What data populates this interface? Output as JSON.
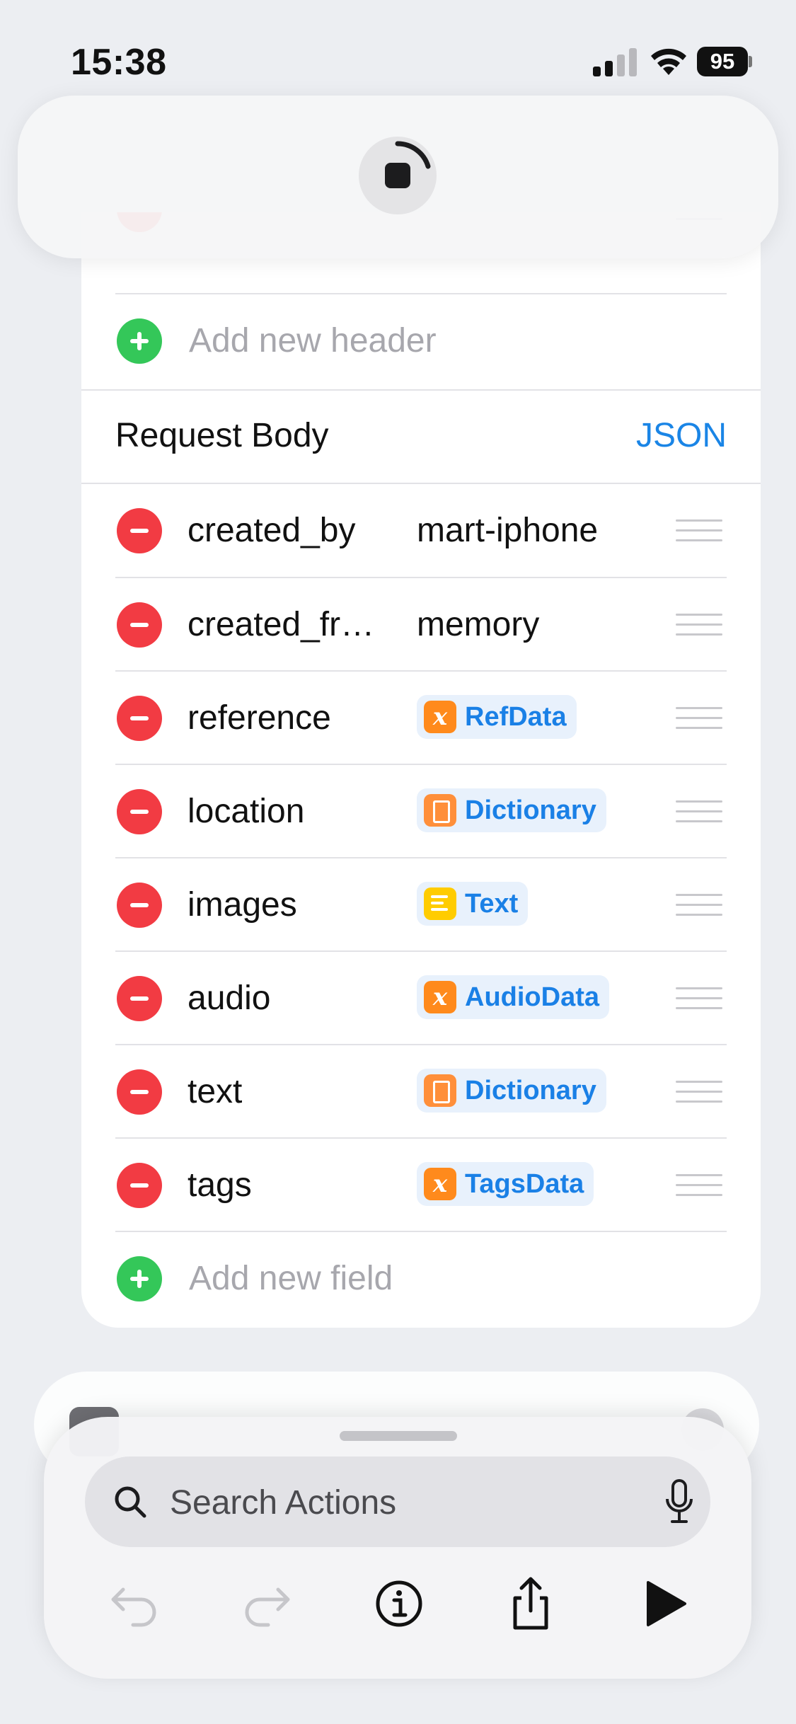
{
  "status_bar": {
    "time": "15:38",
    "battery": "95"
  },
  "headers": {
    "add_placeholder": "Add new header"
  },
  "request_body": {
    "title": "Request Body",
    "format": "JSON",
    "fields": [
      {
        "key": "created_by",
        "type": "text",
        "value": "mart-iphone"
      },
      {
        "key": "created_fr…",
        "type": "text",
        "value": "memory"
      },
      {
        "key": "reference",
        "type": "variable",
        "value": "RefData",
        "icon": "variable-x-icon",
        "color": "#ff8a1c"
      },
      {
        "key": "location",
        "type": "variable",
        "value": "Dictionary",
        "icon": "dictionary-book-icon",
        "color": "#ff8f3a"
      },
      {
        "key": "images",
        "type": "variable",
        "value": "Text",
        "icon": "text-lines-icon",
        "color": "#ffcc00"
      },
      {
        "key": "audio",
        "type": "variable",
        "value": "AudioData",
        "icon": "variable-x-icon",
        "color": "#ff8a1c"
      },
      {
        "key": "text",
        "type": "variable",
        "value": "Dictionary",
        "icon": "dictionary-book-icon",
        "color": "#ff8f3a"
      },
      {
        "key": "tags",
        "type": "variable",
        "value": "TagsData",
        "icon": "variable-x-icon",
        "color": "#ff8a1c"
      }
    ],
    "add_placeholder": "Add new field"
  },
  "search": {
    "placeholder": "Search Actions"
  },
  "colors": {
    "accent": "#1a85e6",
    "destructive": "#f23b43",
    "add": "#34c759"
  }
}
